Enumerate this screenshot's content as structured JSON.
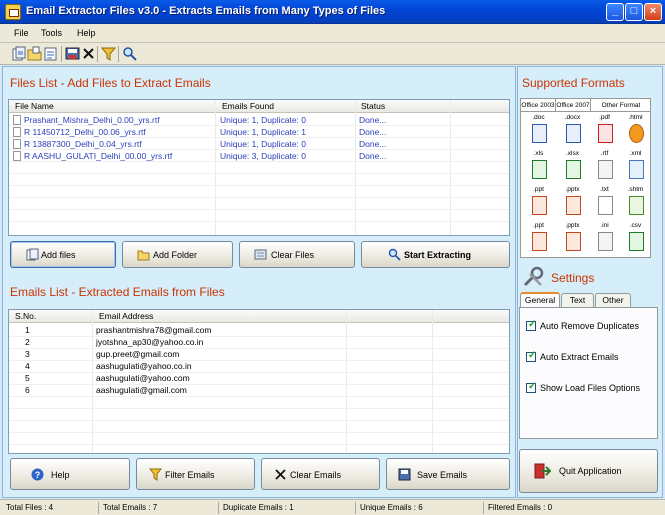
{
  "window": {
    "title": "Email Extractor Files v3.0 - Extracts Emails from Many Types of Files",
    "minimize": "_",
    "maximize": "□",
    "close": "×"
  },
  "menu": [
    "File",
    "Tools",
    "Help"
  ],
  "toolbar_icons": [
    "add-files-icon",
    "add-folder-icon",
    "export-icon",
    "save-icon",
    "clear-icon",
    "filter-icon",
    "search-icon"
  ],
  "files_section": {
    "title": "Files List - Add Files to Extract Emails",
    "columns": [
      "File Name",
      "Emails Found",
      "Status"
    ],
    "rows": [
      {
        "name": "Prashant_Mishra_Delhi_0.00_yrs.rtf",
        "found": "Unique: 1, Duplicate: 0",
        "status": "Done..."
      },
      {
        "name": "R 11450712_Delhi_00.06_yrs.rtf",
        "found": "Unique: 1, Duplicate: 1",
        "status": "Done..."
      },
      {
        "name": "R 13887300_Delhi_0.04_yrs.rtf",
        "found": "Unique: 1, Duplicate: 0",
        "status": "Done..."
      },
      {
        "name": "R AASHU_GULATI_Delhi_00.00_yrs.rtf",
        "found": "Unique: 3, Duplicate: 0",
        "status": "Done..."
      }
    ],
    "buttons": {
      "add_files": "Add files",
      "add_folder": "Add Folder",
      "clear_files": "Clear Files",
      "start": "Start Extracting"
    }
  },
  "emails_section": {
    "title": "Emails List - Extracted Emails from Files",
    "columns": [
      "S.No.",
      "Email Address"
    ],
    "rows": [
      {
        "sno": "1",
        "email": "prashantmishra78@gmail.com"
      },
      {
        "sno": "2",
        "email": "jyotshna_ap30@yahoo.co.in"
      },
      {
        "sno": "3",
        "email": "gup.preet@gmail.com"
      },
      {
        "sno": "4",
        "email": "aashugulati@yahoo.co.in"
      },
      {
        "sno": "5",
        "email": "aashugulati@yahoo.com"
      },
      {
        "sno": "6",
        "email": "aashugulati@gmail.com"
      }
    ],
    "buttons": {
      "help": "Help",
      "filter": "Filter Emails",
      "clear": "Clear Emails",
      "save": "Save Emails"
    }
  },
  "formats": {
    "title": "Supported Formats",
    "headers": [
      "Office 2003",
      "Office 2007",
      "Other Format"
    ],
    "cells": [
      [
        ".doc",
        ".docx",
        ".pdf",
        ".html"
      ],
      [
        ".xls",
        ".xlsx",
        ".rtf",
        ".xml"
      ],
      [
        ".ppt",
        ".pptx",
        ".txt",
        ".shtm"
      ],
      [
        ".ppt",
        ".pptx",
        ".ini",
        ".csv"
      ]
    ]
  },
  "settings": {
    "title": "Settings",
    "tabs": [
      "General",
      "Text",
      "Other"
    ],
    "options": [
      "Auto Remove Duplicates",
      "Auto Extract Emails",
      "Show Load Files Options"
    ]
  },
  "quit_label": "Quit Application",
  "status": {
    "total_files": "Total Files :  4",
    "total_emails": "Total Emails :  7",
    "duplicate": "Duplicate Emails :  1",
    "unique": "Unique Emails :  6",
    "filtered": "Filtered Emails :  0"
  },
  "colors": {
    "title_bar": "#0246d6",
    "section_title": "#cc3300",
    "panel_bg": "#d5eefa",
    "link_blue": "#2a3eb8"
  }
}
